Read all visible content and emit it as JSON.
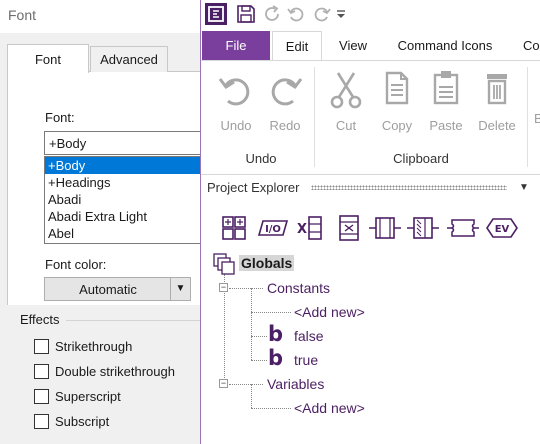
{
  "font_dialog": {
    "title": "Font",
    "tabs": [
      "Font",
      "Advanced"
    ],
    "font_label": "Font:",
    "font_value": "+Body",
    "font_options": [
      "+Body",
      "+Headings",
      "Abadi",
      "Abadi Extra Light",
      "Abel"
    ],
    "selected_font_index": 0,
    "color_label": "Font color:",
    "color_value": "Automatic",
    "effects_label": "Effects",
    "effects": [
      {
        "label": "Strikethrough",
        "checked": false
      },
      {
        "label": "Double strikethrough",
        "checked": false
      },
      {
        "label": "Superscript",
        "checked": false
      },
      {
        "label": "Subscript",
        "checked": false
      }
    ]
  },
  "app": {
    "ribbon_tabs": {
      "file": "File",
      "edit": "Edit",
      "view": "View",
      "command_icons": "Command Icons",
      "cut_off": "Co"
    },
    "active_tab": "Edit",
    "ribbon_buttons": {
      "undo": "Undo",
      "redo": "Redo",
      "cut": "Cut",
      "copy": "Copy",
      "paste": "Paste",
      "delete": "Delete",
      "partial": "B"
    },
    "groups": {
      "undo": "Undo",
      "clipboard": "Clipboard"
    },
    "project_explorer": {
      "title": "Project Explorer",
      "tree": {
        "globals": "Globals",
        "constants": "Constants",
        "add_new_constant": "<Add new>",
        "const_false": "false",
        "const_true": "true",
        "variables": "Variables",
        "add_new_variable": "<Add new>"
      }
    },
    "colors": {
      "accent": "#7a3f9d",
      "tree_text": "#4b1f63",
      "disabled_icon": "#a8a8a8"
    }
  }
}
